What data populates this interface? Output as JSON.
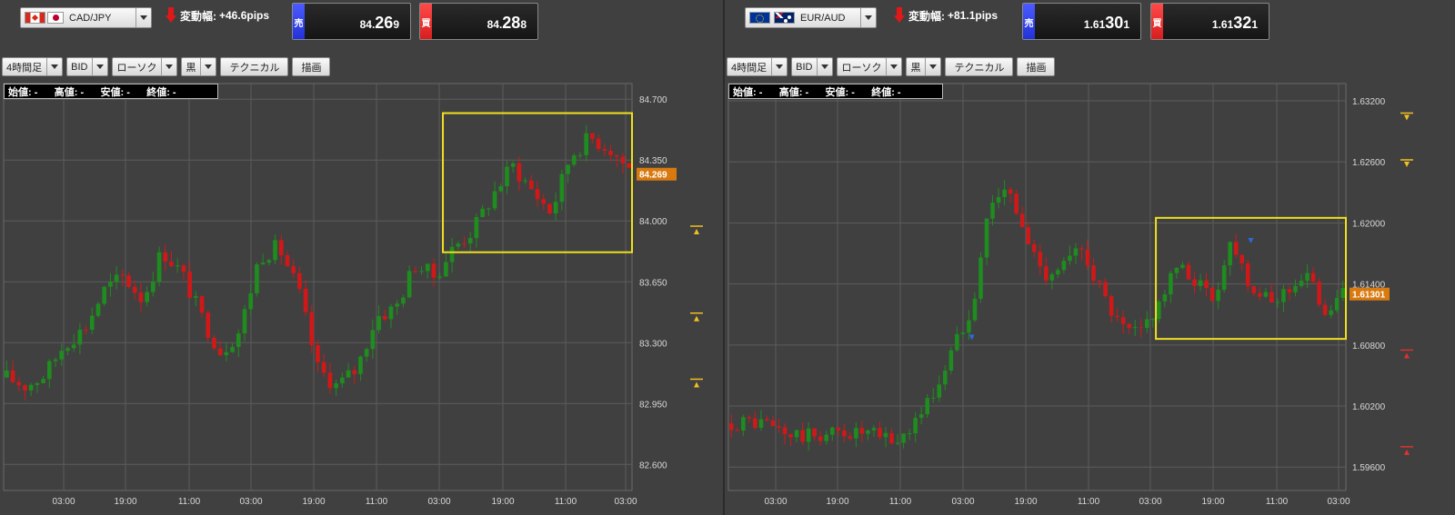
{
  "panels": [
    {
      "pair": "CAD/JPY",
      "flags": [
        "flag-ca",
        "flag-jp"
      ],
      "change_label": "変動幅:",
      "change_value": "+46.6pips",
      "sell": {
        "tag": "売",
        "a": "84.",
        "b": "26",
        "c": "9"
      },
      "buy": {
        "tag": "買",
        "a": "84.",
        "b": "28",
        "c": "8"
      },
      "toolbar": {
        "timeframe": "4時間足",
        "price_type": "BID",
        "chart_type": "ローソク",
        "color": "黒",
        "technical": "テクニカル",
        "draw": "描画"
      },
      "ohlc": {
        "open": "始値: -",
        "high": "高値: -",
        "low": "安値: -",
        "close": "終値: -"
      },
      "chart_data": {
        "type": "candlestick",
        "ylim": [
          82.45,
          84.79
        ],
        "yticks": [
          "84.700",
          "84.350",
          "84.000",
          "83.650",
          "83.300",
          "82.950",
          "82.600"
        ],
        "xticks": [
          "03:00",
          "19:00",
          "11:00",
          "03:00",
          "19:00",
          "11:00",
          "03:00",
          "19:00",
          "11:00",
          "03:00"
        ],
        "current_price": "84.269",
        "highlight_box": {
          "x_range": [
            72,
            103
          ],
          "y_range": [
            83.82,
            84.62
          ]
        },
        "candles_start": [
          83.1,
          83.05,
          83.12,
          83.3,
          83.38,
          83.6,
          83.68,
          83.55,
          83.83,
          83.7,
          83.45,
          83.25,
          83.37,
          83.8,
          83.85,
          83.6,
          83.15,
          83.05,
          83.15,
          83.45,
          83.5,
          83.75,
          83.68,
          83.85,
          83.95,
          84.15,
          84.32,
          84.18,
          84.05,
          84.38,
          84.48,
          84.42,
          84.3
        ],
        "up_color": "#1e8c1e",
        "down_color": "#d01818",
        "markers": [
          {
            "x": 115.5,
            "y": 83.97,
            "color": "#f0c020",
            "dir": "up"
          },
          {
            "x": 115.5,
            "y": 83.47,
            "color": "#f0c020",
            "dir": "up"
          },
          {
            "x": 115.5,
            "y": 83.09,
            "color": "#f0c020",
            "dir": "up"
          }
        ],
        "n_candles": 103
      }
    },
    {
      "pair": "EUR/AUD",
      "flags": [
        "flag-eu",
        "flag-au"
      ],
      "change_label": "変動幅:",
      "change_value": "+81.1pips",
      "sell": {
        "tag": "売",
        "a": "1.61",
        "b": "30",
        "c": "1"
      },
      "buy": {
        "tag": "買",
        "a": "1.61",
        "b": "32",
        "c": "1"
      },
      "toolbar": {
        "timeframe": "4時間足",
        "price_type": "BID",
        "chart_type": "ローソク",
        "color": "黒",
        "technical": "テクニカル",
        "draw": "描画"
      },
      "ohlc": {
        "open": "始値: -",
        "high": "高値: -",
        "low": "安値: -",
        "close": "終値: -"
      },
      "chart_data": {
        "type": "candlestick",
        "ylim": [
          1.5937,
          1.6337
        ],
        "yticks": [
          "1.63200",
          "1.62600",
          "1.62000",
          "1.61400",
          "1.60800",
          "1.60200",
          "1.59600"
        ],
        "xticks": [
          "03:00",
          "19:00",
          "11:00",
          "03:00",
          "19:00",
          "11:00",
          "03:00",
          "19:00",
          "11:00",
          "03:00"
        ],
        "current_price": "1.61301",
        "highlight_box": {
          "x_range": [
            72,
            104
          ],
          "y_range": [
            1.6086,
            1.6205
          ]
        },
        "candles_start": [
          1.6003,
          1.6005,
          1.6002,
          1.5992,
          1.599,
          1.5992,
          1.5995,
          1.5993,
          1.599,
          1.5985,
          1.6008,
          1.6035,
          1.6078,
          1.612,
          1.6225,
          1.623,
          1.618,
          1.615,
          1.616,
          1.6175,
          1.613,
          1.6095,
          1.609,
          1.612,
          1.6155,
          1.6145,
          1.6125,
          1.6185,
          1.614,
          1.612,
          1.6135,
          1.615,
          1.6115,
          1.613
        ],
        "up_color": "#1e8c1e",
        "down_color": "#d01818",
        "markers": [
          {
            "x": 115.5,
            "y": 1.6308,
            "color": "#f0c020",
            "dir": "down"
          },
          {
            "x": 115.5,
            "y": 1.6262,
            "color": "#f0c020",
            "dir": "down"
          },
          {
            "x": 115.5,
            "y": 1.6075,
            "color": "#e03030",
            "dir": "up"
          },
          {
            "x": 115.5,
            "y": 1.598,
            "color": "#e03030",
            "dir": "up"
          },
          {
            "x": 40.5,
            "y": 1.6092,
            "color": "#2a6ae0",
            "dir": "down"
          },
          {
            "x": 87.5,
            "y": 1.6187,
            "color": "#2a6ae0",
            "dir": "down"
          }
        ],
        "n_candles": 104
      }
    }
  ]
}
